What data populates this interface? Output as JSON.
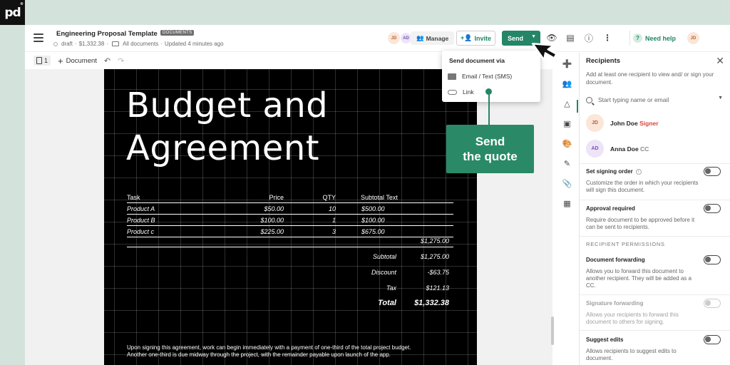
{
  "brand": {
    "logo": "pd",
    "mark": "®"
  },
  "header": {
    "doc_title": "Engineering Proposal Template",
    "badge": "DOCUMENTS",
    "status": "draft",
    "amount": "$1,332.38",
    "folder": "All documents",
    "updated": "Updated 4 minutes ago",
    "sep": "·",
    "avatars": [
      "JD",
      "AD"
    ],
    "manage_label": "Manage",
    "invite_label": "Invite",
    "send_label": "Send",
    "help_label": "Need help",
    "user_avatar": "JD",
    "icons": [
      "menu-icon",
      "manage-icon",
      "invite-icon",
      "chevron-down-icon",
      "eye-icon",
      "chat-icon",
      "info-icon",
      "more-icon",
      "help-icon"
    ]
  },
  "toolbar": {
    "page_count": "1",
    "add_document_label": "Document",
    "undo": "↶",
    "redo": "↷"
  },
  "document": {
    "title_line1": "Budget and",
    "title_line2": "Agreement",
    "table": {
      "headers": {
        "task": "Task",
        "price": "Price",
        "qty": "QTY",
        "subtotal": "Subtotal Text"
      },
      "rows": [
        {
          "task": "Product A",
          "price": "$50.00",
          "qty": "10",
          "subtotal": "$500.00"
        },
        {
          "task": "Product B",
          "price": "$100.00",
          "qty": "1",
          "subtotal": "$100.00"
        },
        {
          "task": "Product c",
          "price": "$225.00",
          "qty": "3",
          "subtotal": "$675.00"
        }
      ],
      "total": "$1,275.00"
    },
    "summary": {
      "subtotal_label": "Subtotal",
      "subtotal": "$1,275.00",
      "discount_label": "Discount",
      "discount": "-$63.75",
      "tax_label": "Tax",
      "tax": "$121.13",
      "total_label": "Total",
      "total": "$1,332.38"
    },
    "footer_line1": "Upon signing this agreement, work can begin immediately with a payment of one-third of the total project budget.",
    "footer_line2": "Another one-third is due midway through the project, with the remainder payable upon launch of the app."
  },
  "send_menu": {
    "title": "Send document via",
    "items": [
      {
        "label": "Email / Text (SMS)",
        "icon": "mail-icon"
      },
      {
        "label": "Link",
        "icon": "link-icon"
      }
    ]
  },
  "callout": {
    "line1": "Send",
    "line2": "the quote"
  },
  "rail": {
    "icons": [
      "add-icon",
      "recipients-icon",
      "content-icon",
      "pricing-icon",
      "design-icon",
      "fields-icon",
      "attachments-icon",
      "apps-icon"
    ]
  },
  "panel": {
    "title": "Recipients",
    "description": "Add at least one recipient to view and/ or sign your document.",
    "search_placeholder": "Start typing name or email",
    "recipients": [
      {
        "initials": "JD",
        "name": "John Doe",
        "role": "Signer"
      },
      {
        "initials": "AD",
        "name": "Anna Doe",
        "role": "CC"
      }
    ],
    "options": [
      {
        "title": "Set signing order",
        "desc": "Customize the order in which your recipients will sign this document.",
        "enabled": true
      },
      {
        "title": "Approval required",
        "desc": "Require document to be approved before it can be sent to recipients.",
        "enabled": true
      },
      {
        "title": "Document forwarding",
        "desc": "Allows you to forward this document to another recipient. They will be added as a CC.",
        "enabled": true
      },
      {
        "title": "Signature forwarding",
        "desc": "Allows your recipients to forward this document to others for signing.",
        "enabled": false
      },
      {
        "title": "Suggest edits",
        "desc": "Allows recipients to suggest edits to document.",
        "enabled": true
      }
    ],
    "section_label": "RECIPIENT PERMISSIONS"
  },
  "colors": {
    "brand_green": "#248567",
    "signer_red": "#d9443a",
    "background": "#d3e3dc"
  }
}
